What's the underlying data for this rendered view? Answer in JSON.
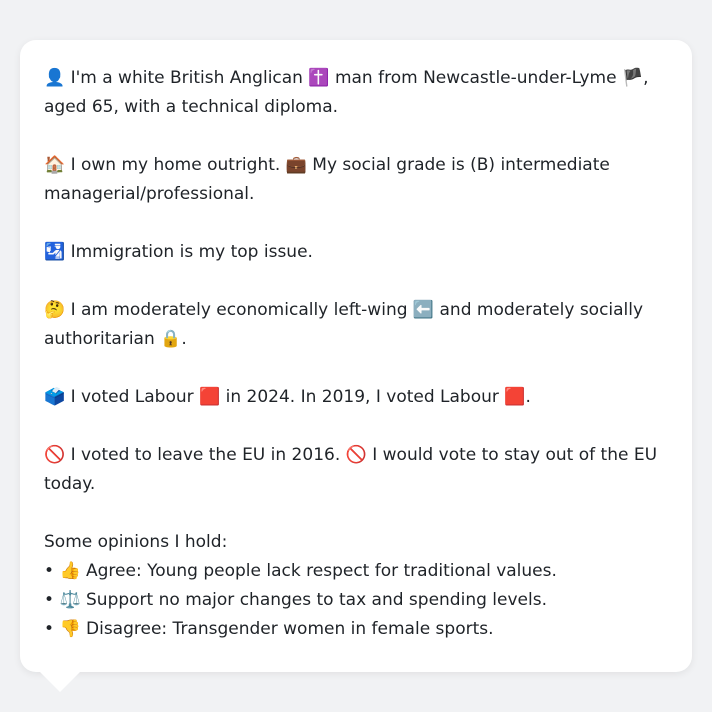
{
  "message": {
    "para1": {
      "icon": "👤",
      "text_a": " I'm a white British Anglican ",
      "icon2": "✝️",
      "text_b": " man from Newcastle-under-Lyme ",
      "icon3": "🏴",
      "text_c": ", aged 65, with a technical diploma."
    },
    "para2": {
      "icon": "🏠",
      "text_a": " I own my home outright. ",
      "icon2": "💼",
      "text_b": " My social grade is (B) intermediate managerial/professional."
    },
    "para3": {
      "icon": "🛂",
      "text_a": " Immigration is my top issue."
    },
    "para4": {
      "icon": "🤔",
      "text_a": " I am moderately economically left-wing ",
      "icon2": "⬅️",
      "text_b": " and moderately socially authoritarian ",
      "icon3": "🔒",
      "text_c": "."
    },
    "para5": {
      "icon": "🗳️",
      "text_a": " I voted Labour ",
      "icon2": "🟥",
      "text_b": " in 2024. In 2019, I voted Labour ",
      "icon3": "🟥",
      "text_c": "."
    },
    "para6": {
      "icon": "🚫",
      "text_a": " I voted to leave the EU in 2016. ",
      "icon2": "🚫",
      "text_b": " I would vote to stay out of the EU today."
    },
    "opinions_heading": "Some opinions I hold:",
    "opinions": [
      {
        "bullet": "•",
        "icon": "👍",
        "text": " Agree: Young people lack respect for traditional values."
      },
      {
        "bullet": "•",
        "icon": "⚖️",
        "text": " Support no major changes to tax and spending levels."
      },
      {
        "bullet": "•",
        "icon": "👎",
        "text": " Disagree: Transgender women in female sports."
      }
    ]
  }
}
